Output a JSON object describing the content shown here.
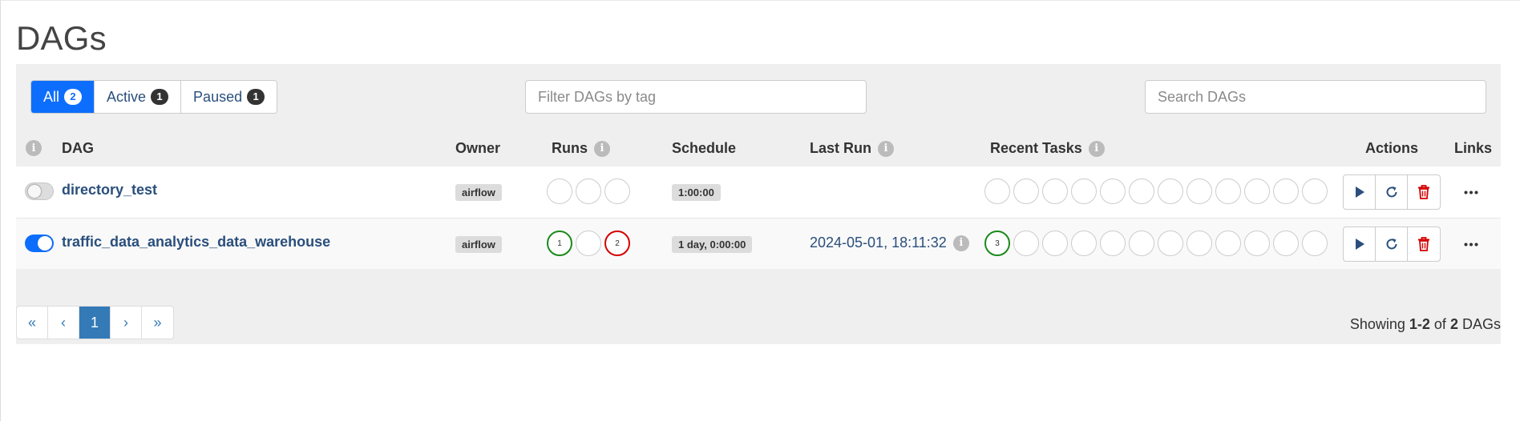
{
  "page": {
    "title": "DAGs"
  },
  "filters": {
    "status": [
      {
        "label": "All",
        "count": "2",
        "active": true
      },
      {
        "label": "Active",
        "count": "1",
        "active": false
      },
      {
        "label": "Paused",
        "count": "1",
        "active": false
      }
    ],
    "tag_placeholder": "Filter DAGs by tag",
    "search_placeholder": "Search DAGs"
  },
  "table": {
    "info_icon": "i",
    "headers": {
      "dag": "DAG",
      "owner": "Owner",
      "runs": "Runs",
      "schedule": "Schedule",
      "last_run": "Last Run",
      "recent_tasks": "Recent Tasks",
      "actions": "Actions",
      "links": "Links"
    },
    "rows": [
      {
        "dag_id": "directory_test",
        "paused": true,
        "owner": "airflow",
        "runs": [
          "",
          "",
          ""
        ],
        "schedule": "1:00:00",
        "last_run": "",
        "recent_tasks": [
          "",
          "",
          "",
          "",
          "",
          "",
          "",
          "",
          "",
          "",
          "",
          ""
        ]
      },
      {
        "dag_id": "traffic_data_analytics_data_warehouse",
        "paused": false,
        "owner": "airflow",
        "runs": [
          "1",
          "",
          "2"
        ],
        "schedule": "1 day, 0:00:00",
        "last_run": "2024-05-01, 18:11:32",
        "recent_tasks": [
          "3",
          "",
          "",
          "",
          "",
          "",
          "",
          "",
          "",
          "",
          "",
          ""
        ]
      }
    ]
  },
  "pagination": {
    "first": "«",
    "prev": "‹",
    "current": "1",
    "next": "›",
    "last": "»"
  },
  "summary": {
    "prefix": "Showing",
    "range": "1-2",
    "of": "of",
    "total": "2",
    "suffix": "DAGs"
  },
  "colors": {
    "primary": "#0d6efd",
    "link": "#2a4f7c",
    "success_ring": "#1a8a1a",
    "failed_ring": "#d40000",
    "delete": "#d40000",
    "action_icon": "#2a4f7c"
  },
  "icons": {
    "trigger": "play-icon",
    "refresh": "refresh-icon",
    "delete": "trash-icon",
    "links": "ellipsis-icon"
  }
}
